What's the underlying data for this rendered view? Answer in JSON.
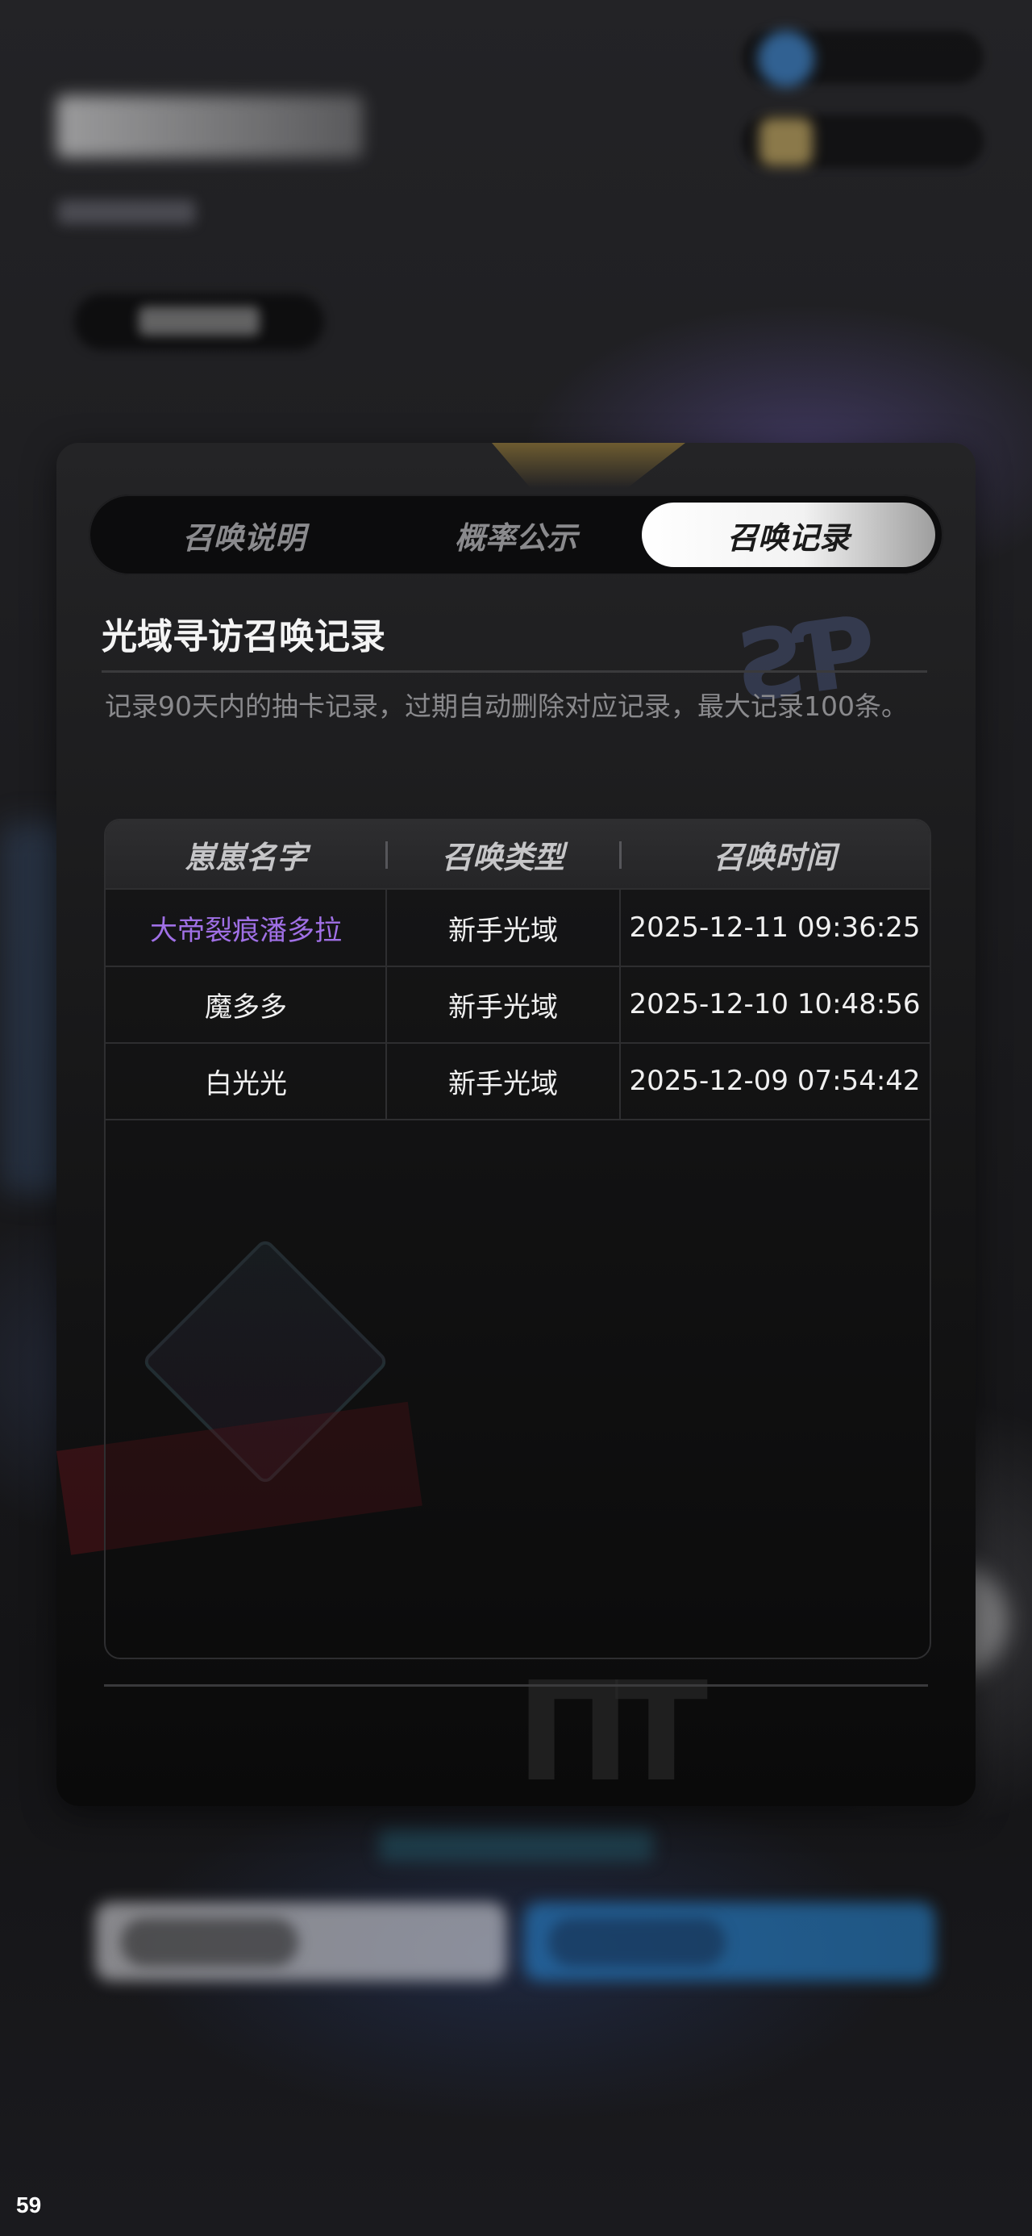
{
  "tabs": [
    {
      "label": "召唤说明",
      "active": false
    },
    {
      "label": "概率公示",
      "active": false
    },
    {
      "label": "召唤记录",
      "active": true
    }
  ],
  "record": {
    "title": "光域寻访召唤记录",
    "description": "记录90天内的抽卡记录，过期自动删除对应记录，最大记录100条。",
    "columns": [
      "崽崽名字",
      "召唤类型",
      "召唤时间"
    ],
    "rows": [
      {
        "name": "大帝裂痕潘多拉",
        "type": "新手光域",
        "time": "2025-12-11 09:36:25",
        "highlight": true
      },
      {
        "name": "魔多多",
        "type": "新手光域",
        "time": "2025-12-10 10:48:56",
        "highlight": false
      },
      {
        "name": "白光光",
        "type": "新手光域",
        "time": "2025-12-09 07:54:42",
        "highlight": false
      }
    ]
  },
  "fps_counter": "59",
  "colors": {
    "accent_purple": "#a070e6",
    "active_tab": "#ffffff",
    "panel_bg": "#1a1a1b"
  }
}
